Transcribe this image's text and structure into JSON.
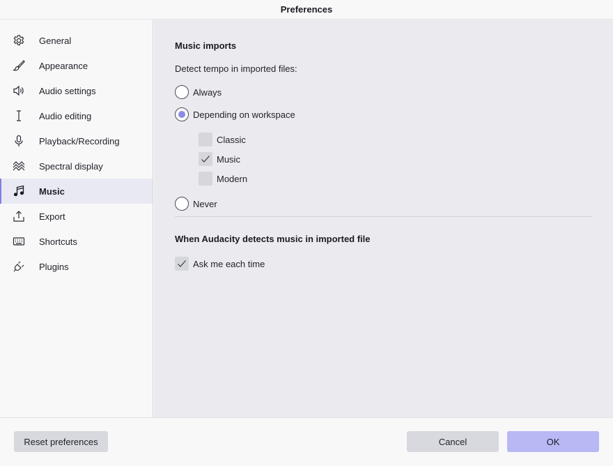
{
  "window": {
    "title": "Preferences"
  },
  "sidebar": {
    "items": [
      {
        "label": "General",
        "icon": "gear-icon"
      },
      {
        "label": "Appearance",
        "icon": "brush-icon"
      },
      {
        "label": "Audio settings",
        "icon": "speaker-icon"
      },
      {
        "label": "Audio editing",
        "icon": "text-cursor-icon"
      },
      {
        "label": "Playback/Recording",
        "icon": "microphone-icon"
      },
      {
        "label": "Spectral display",
        "icon": "waves-icon"
      },
      {
        "label": "Music",
        "icon": "music-note-icon",
        "active": true
      },
      {
        "label": "Export",
        "icon": "upload-icon"
      },
      {
        "label": "Shortcuts",
        "icon": "keyboard-icon"
      },
      {
        "label": "Plugins",
        "icon": "plug-icon"
      }
    ]
  },
  "main": {
    "music_imports": {
      "heading": "Music imports",
      "question": "Detect tempo in imported files:",
      "options": [
        {
          "label": "Always",
          "checked": false
        },
        {
          "label": "Depending on workspace",
          "checked": true
        },
        {
          "label": "Never",
          "checked": false
        }
      ],
      "workspaces": [
        {
          "label": "Classic",
          "checked": false
        },
        {
          "label": "Music",
          "checked": true
        },
        {
          "label": "Modern",
          "checked": false
        }
      ]
    },
    "detection": {
      "heading": "When Audacity detects music in imported file",
      "ask_label": "Ask me each time",
      "ask_checked": true
    }
  },
  "footer": {
    "reset_label": "Reset preferences",
    "cancel_label": "Cancel",
    "ok_label": "OK"
  },
  "colors": {
    "accent": "#8b8be6",
    "primary_button": "#b8b8f4",
    "active_nav": "#e9e9f3"
  }
}
